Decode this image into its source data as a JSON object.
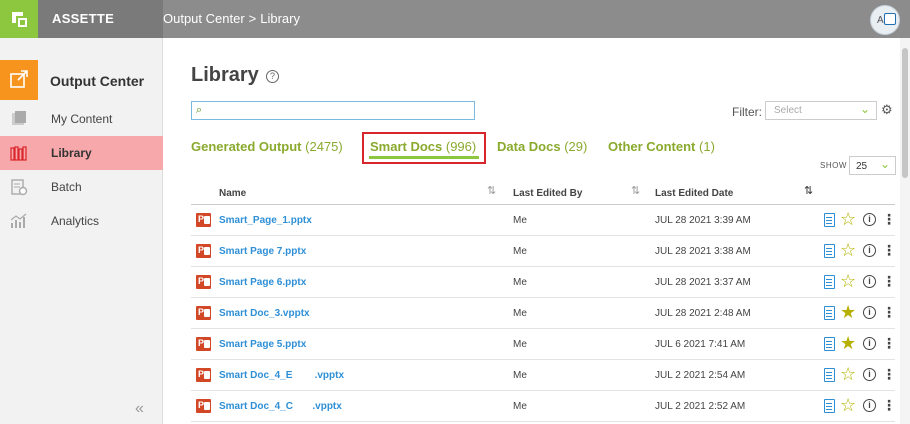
{
  "app": {
    "brand": "ASSETTE",
    "avatar_initial": "A"
  },
  "breadcrumb": {
    "parent": "Output Center",
    "separator": ">",
    "current": "Library"
  },
  "sidebar": {
    "section_title": "Output Center",
    "items": [
      {
        "label": "My Content",
        "icon": "my-content-icon",
        "active": false
      },
      {
        "label": "Library",
        "icon": "library-icon",
        "active": true
      },
      {
        "label": "Batch",
        "icon": "batch-icon",
        "active": false
      },
      {
        "label": "Analytics",
        "icon": "analytics-icon",
        "active": false
      }
    ],
    "collapse_glyph": "«"
  },
  "main": {
    "title": "Library",
    "help_glyph": "?",
    "search": {
      "value": "",
      "placeholder": ""
    },
    "filter": {
      "label": "Filter:",
      "placeholder": "Select"
    },
    "tabs": [
      {
        "label": "Generated Output",
        "count": "(2475)"
      },
      {
        "label": "Smart Docs",
        "count": "(996)",
        "active": true
      },
      {
        "label": "Data Docs",
        "count": "(29)"
      },
      {
        "label": "Other Content",
        "count": "(1)"
      }
    ],
    "show": {
      "label": "SHOW",
      "value": "25"
    },
    "table": {
      "headers": [
        "Name",
        "Last Edited By",
        "Last Edited Date"
      ],
      "rows": [
        {
          "name": "Smart_Page_1.pptx",
          "editor": "Me",
          "date": "JUL 28 2021 3:39 AM",
          "starred": false
        },
        {
          "name": "Smart Page 7.pptx",
          "editor": "Me",
          "date": "JUL 28 2021 3:38 AM",
          "starred": false
        },
        {
          "name": "Smart Page 6.pptx",
          "editor": "Me",
          "date": "JUL 28 2021 3:37 AM",
          "starred": false
        },
        {
          "name": "Smart Doc_3.vpptx",
          "editor": "Me",
          "date": "JUL 28 2021 2:48 AM",
          "starred": true
        },
        {
          "name": "Smart Page 5.pptx",
          "editor": "Me",
          "date": "JUL 6 2021 7:41 AM",
          "starred": true
        },
        {
          "name": "Smart Doc_4_E        .vpptx",
          "editor": "Me",
          "date": "JUL 2 2021 2:54 AM",
          "starred": false
        },
        {
          "name": "Smart Doc_4_C       .vpptx",
          "editor": "Me",
          "date": "JUL 2 2021 2:52 AM",
          "starred": false
        }
      ]
    }
  },
  "colors": {
    "accent_green": "#8dc63f",
    "tab_green": "#8aaa2e",
    "active_nav": "#f7a8ab",
    "output_center_orange": "#f7941d",
    "link_blue": "#2e8fd6",
    "highlight_red": "#d9252a"
  }
}
